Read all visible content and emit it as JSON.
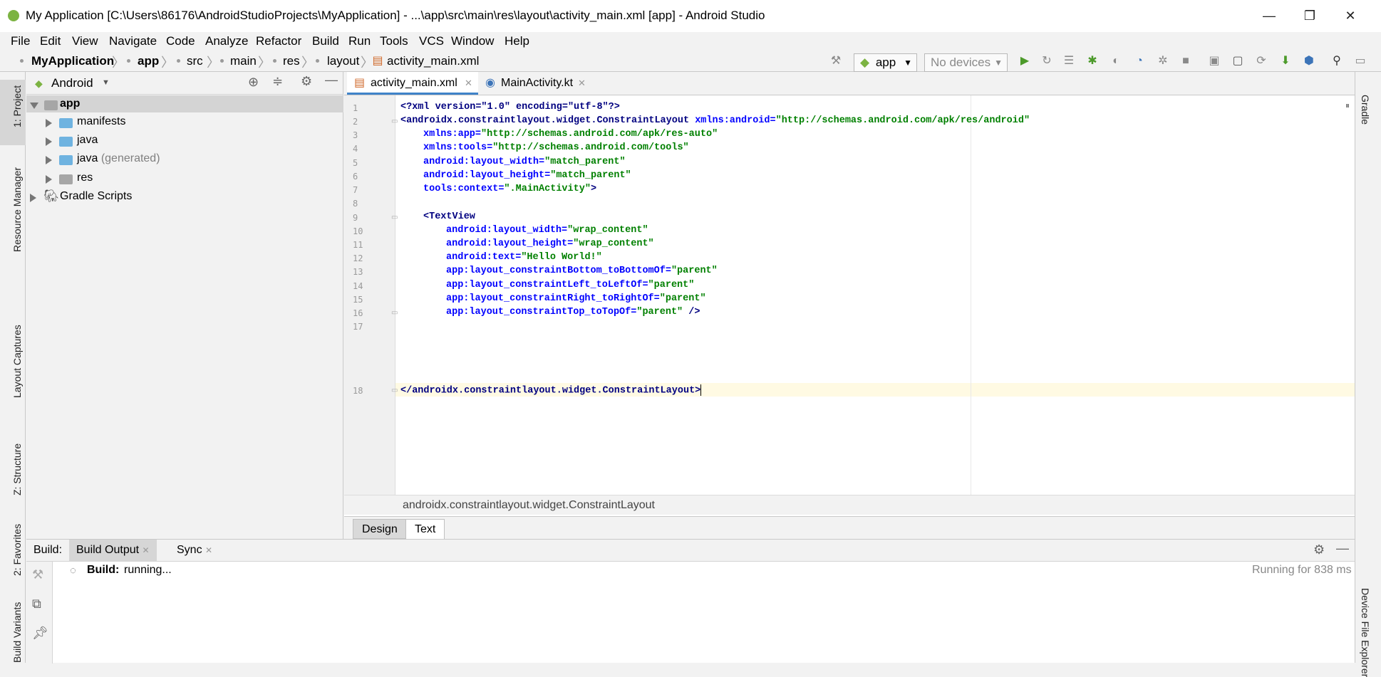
{
  "window": {
    "title": "My Application [C:\\Users\\86176\\AndroidStudioProjects\\MyApplication] - ...\\app\\src\\main\\res\\layout\\activity_main.xml [app] - Android Studio",
    "minimize": "—",
    "maximize": "❐",
    "close": "✕"
  },
  "menu": [
    "File",
    "Edit",
    "View",
    "Navigate",
    "Code",
    "Analyze",
    "Refactor",
    "Build",
    "Run",
    "Tools",
    "VCS",
    "Window",
    "Help"
  ],
  "nav": {
    "crumbs": [
      "MyApplication",
      "app",
      "src",
      "main",
      "res",
      "layout",
      "activity_main.xml"
    ],
    "run_config": "app",
    "device": "No devices"
  },
  "left_strip": [
    "1: Project",
    "Resource Manager",
    "Layout Captures",
    "Z: Structure",
    "2: Favorites",
    "Build Variants"
  ],
  "right_strip": [
    "Gradle",
    "Device File Explorer"
  ],
  "project": {
    "view": "Android",
    "tree": [
      {
        "label": "app",
        "bold": true
      },
      {
        "label": "manifests"
      },
      {
        "label": "java"
      },
      {
        "label": "java",
        "suffix": "(generated)"
      },
      {
        "label": "res"
      },
      {
        "label": "Gradle Scripts"
      }
    ]
  },
  "editor": {
    "tabs": [
      {
        "label": "activity_main.xml",
        "active": true
      },
      {
        "label": "MainActivity.kt",
        "active": false
      }
    ],
    "line_numbers": [
      "1",
      "2",
      "3",
      "4",
      "5",
      "6",
      "7",
      "8",
      "9",
      "10",
      "11",
      "12",
      "13",
      "14",
      "15",
      "16",
      "17",
      "18"
    ],
    "code": {
      "l1": "<?xml version=\"1.0\" encoding=\"utf-8\"?>",
      "l2_tag": "<androidx.constraintlayout.widget.ConstraintLayout",
      "l2_attr": "xmlns:android=",
      "l2_val": "\"http://schemas.android.com/apk/res/android\"",
      "l3_attr": "xmlns:app=",
      "l3_val": "\"http://schemas.android.com/apk/res-auto\"",
      "l4_attr": "xmlns:tools=",
      "l4_val": "\"http://schemas.android.com/tools\"",
      "l5_attr": "android:layout_width=",
      "l5_val": "\"match_parent\"",
      "l6_attr": "android:layout_height=",
      "l6_val": "\"match_parent\"",
      "l7_attr": "tools:context=",
      "l7_val": "\".MainActivity\"",
      "l7_end": ">",
      "l9_tag": "<TextView",
      "l10_attr": "android:layout_width=",
      "l10_val": "\"wrap_content\"",
      "l11_attr": "android:layout_height=",
      "l11_val": "\"wrap_content\"",
      "l12_attr": "android:text=",
      "l12_val": "\"Hello World!\"",
      "l13_attr": "app:layout_constraintBottom_toBottomOf=",
      "l13_val": "\"parent\"",
      "l14_attr": "app:layout_constraintLeft_toLeftOf=",
      "l14_val": "\"parent\"",
      "l15_attr": "app:layout_constraintRight_toRightOf=",
      "l15_val": "\"parent\"",
      "l16_attr": "app:layout_constraintTop_toTopOf=",
      "l16_val": "\"parent\"",
      "l16_end": " />",
      "l18": "</androidx.constraintlayout.widget.ConstraintLayout>"
    },
    "breadcrumb": "androidx.constraintlayout.widget.ConstraintLayout",
    "mode_tabs": [
      "Design",
      "Text"
    ]
  },
  "build": {
    "label": "Build:",
    "tabs": [
      "Build Output",
      "Sync"
    ],
    "status_bold": "Build:",
    "status": "running...",
    "elapsed": "Running for 838 ms"
  }
}
